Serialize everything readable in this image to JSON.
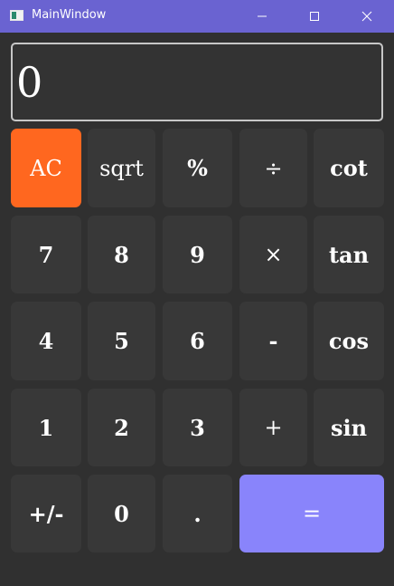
{
  "window": {
    "title": "MainWindow",
    "controls": {
      "minimize_icon": "minimize-icon",
      "maximize_icon": "maximize-icon",
      "close_icon": "close-icon"
    }
  },
  "display": {
    "value": "0"
  },
  "keys": {
    "ac": "AC",
    "sqrt": "sqrt",
    "percent": "%",
    "divide": "÷",
    "cot": "cot",
    "seven": "7",
    "eight": "8",
    "nine": "9",
    "multiply": "×",
    "tan": "tan",
    "four": "4",
    "five": "5",
    "six": "6",
    "minus": "-",
    "cos": "cos",
    "one": "1",
    "two": "2",
    "three": "3",
    "plus": "+",
    "sin": "sin",
    "negate": "+/-",
    "zero": "0",
    "decimal": ".",
    "equals": "="
  },
  "colors": {
    "titlebar": "#6a63d1",
    "background": "#303030",
    "key": "#383838",
    "clear_key": "#ff671f",
    "equals_key": "#8984fb",
    "display_border": "#c7c7c7"
  }
}
